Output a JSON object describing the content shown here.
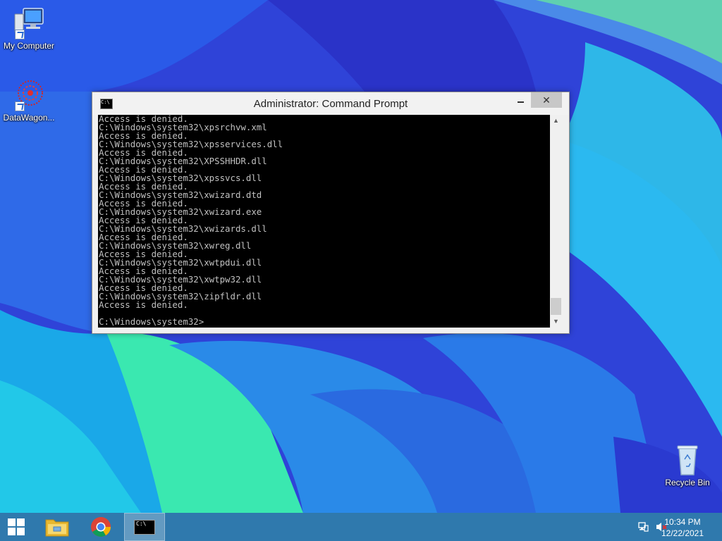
{
  "desktop": {
    "icons": [
      {
        "label": "My Computer"
      },
      {
        "label": "DataWagon..."
      },
      {
        "label": "Recycle Bin"
      }
    ]
  },
  "cmd_window": {
    "title": "Administrator: Command Prompt",
    "lines": [
      "Access is denied.",
      "C:\\Windows\\system32\\xpsrchvw.xml",
      "Access is denied.",
      "C:\\Windows\\system32\\xpsservices.dll",
      "Access is denied.",
      "C:\\Windows\\system32\\XPSSHHDR.dll",
      "Access is denied.",
      "C:\\Windows\\system32\\xpssvcs.dll",
      "Access is denied.",
      "C:\\Windows\\system32\\xwizard.dtd",
      "Access is denied.",
      "C:\\Windows\\system32\\xwizard.exe",
      "Access is denied.",
      "C:\\Windows\\system32\\xwizards.dll",
      "Access is denied.",
      "C:\\Windows\\system32\\xwreg.dll",
      "Access is denied.",
      "C:\\Windows\\system32\\xwtpdui.dll",
      "Access is denied.",
      "C:\\Windows\\system32\\xwtpw32.dll",
      "Access is denied.",
      "C:\\Windows\\system32\\zipfldr.dll",
      "Access is denied."
    ],
    "prompt": "C:\\Windows\\system32>"
  },
  "taskbar": {
    "clock_time": "10:34 PM",
    "clock_date": "12/22/2021",
    "cmd_icon_text": "C:\\"
  },
  "colors": {
    "console_bg": "#000000",
    "console_text": "#c0c0c0",
    "taskbar": "#2f79ad"
  }
}
